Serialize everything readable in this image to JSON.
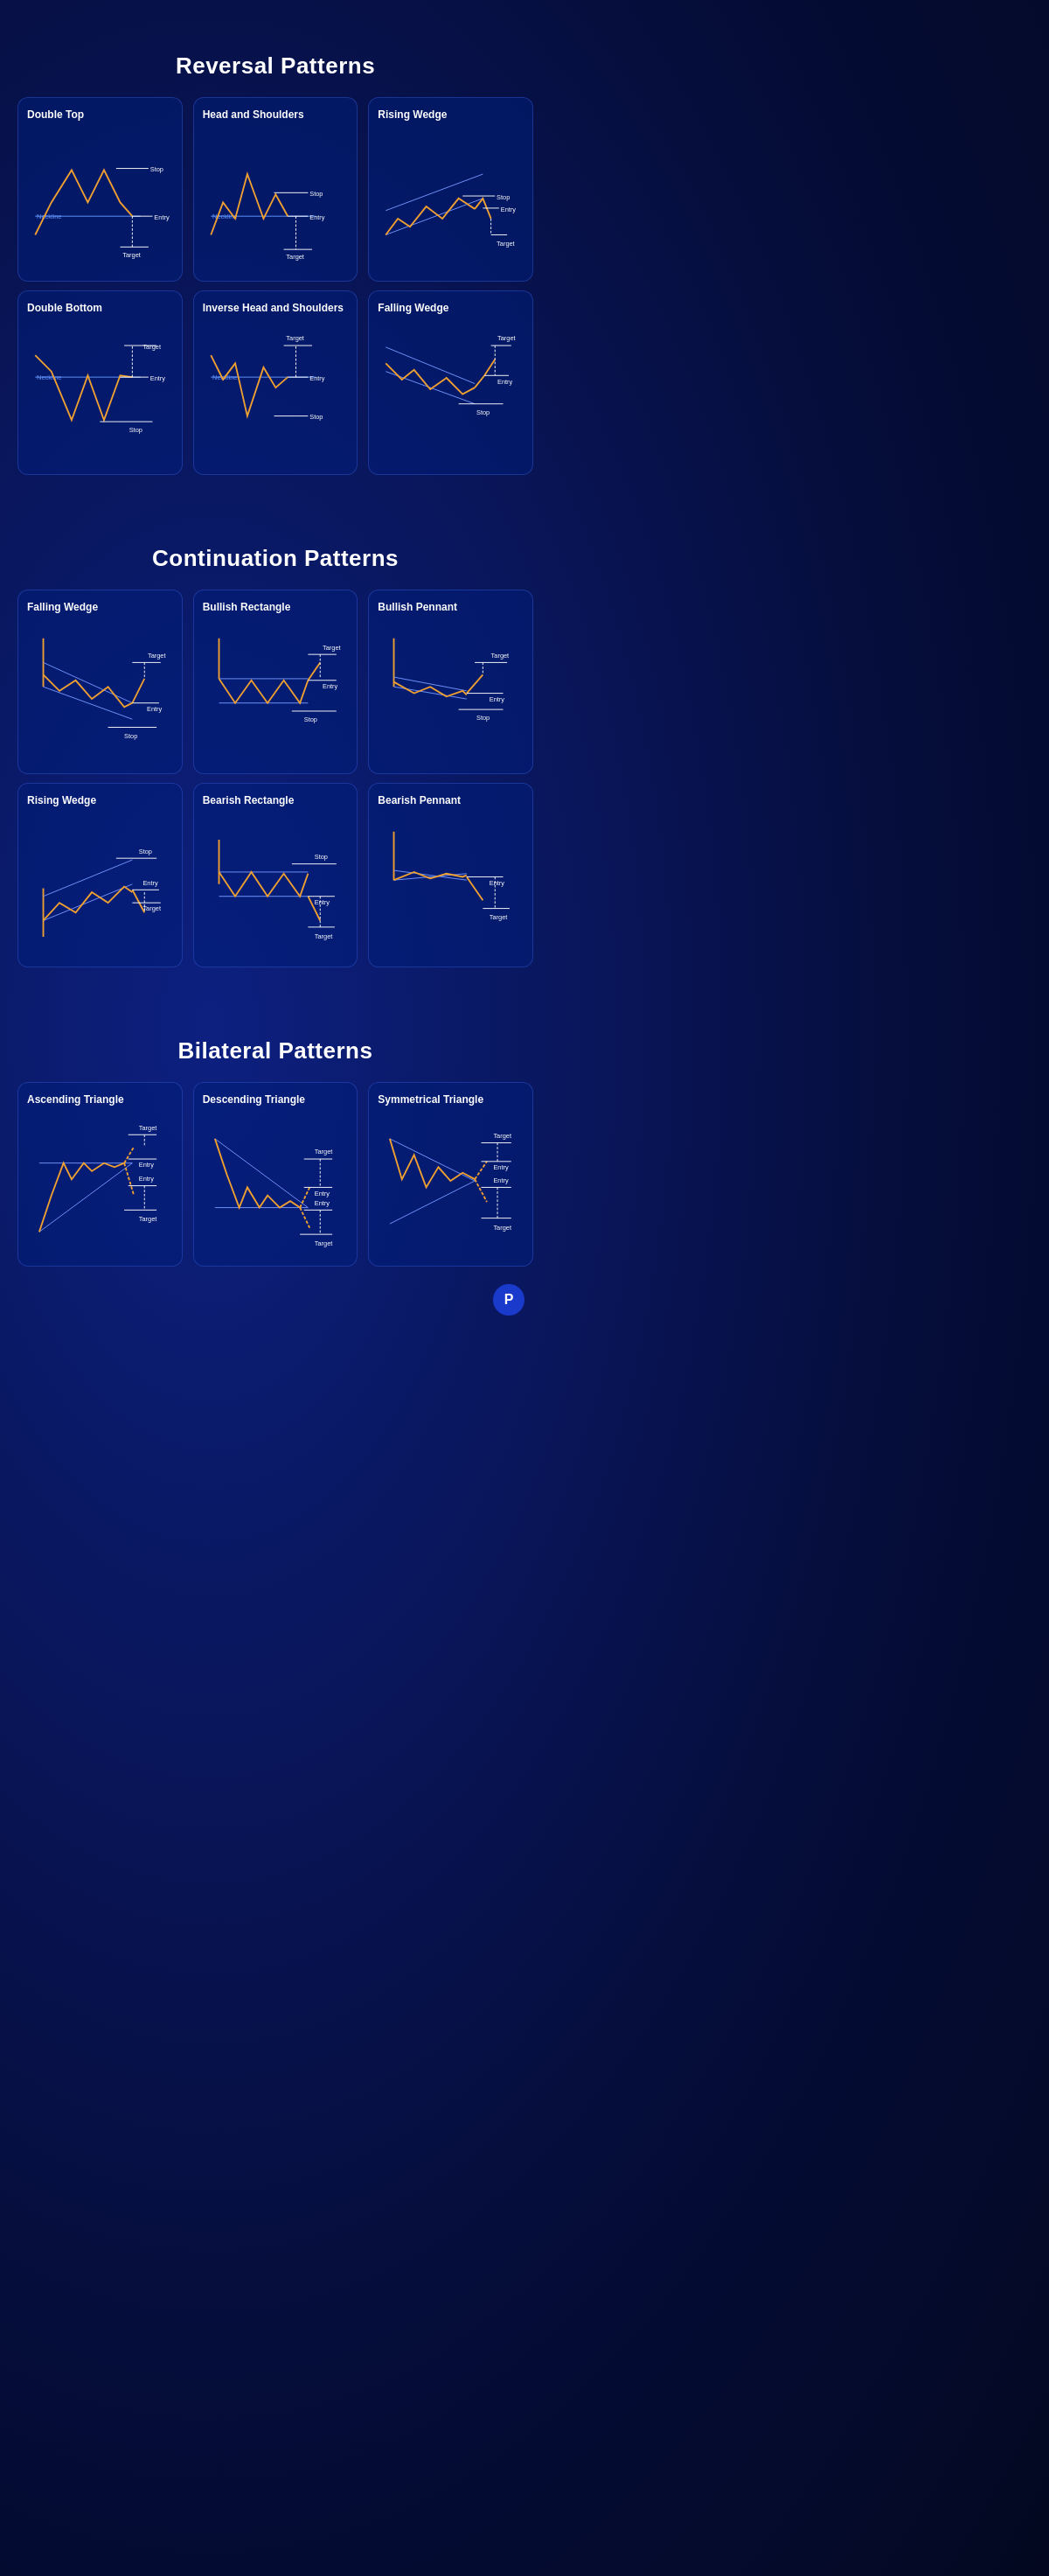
{
  "sections": [
    {
      "title": "Reversal Patterns",
      "rows": [
        [
          {
            "name": "Double Top",
            "type": "double_top"
          },
          {
            "name": "Head and Shoulders",
            "type": "head_shoulders"
          },
          {
            "name": "Rising Wedge",
            "type": "rising_wedge_rev"
          }
        ],
        [
          {
            "name": "Double Bottom",
            "type": "double_bottom"
          },
          {
            "name": "Inverse Head and Shoulders",
            "type": "inv_head_shoulders"
          },
          {
            "name": "Falling Wedge",
            "type": "falling_wedge_rev"
          }
        ]
      ]
    },
    {
      "title": "Continuation Patterns",
      "rows": [
        [
          {
            "name": "Falling Wedge",
            "type": "falling_wedge_cont"
          },
          {
            "name": "Bullish Rectangle",
            "type": "bullish_rectangle"
          },
          {
            "name": "Bullish Pennant",
            "type": "bullish_pennant"
          }
        ],
        [
          {
            "name": "Rising Wedge",
            "type": "rising_wedge_cont"
          },
          {
            "name": "Bearish Rectangle",
            "type": "bearish_rectangle"
          },
          {
            "name": "Bearish Pennant",
            "type": "bearish_pennant"
          }
        ]
      ]
    },
    {
      "title": "Bilateral Patterns",
      "rows": [
        [
          {
            "name": "Ascending Triangle",
            "type": "ascending_triangle"
          },
          {
            "name": "Descending Triangle",
            "type": "descending_triangle"
          },
          {
            "name": "Symmetrical Triangle",
            "type": "symmetrical_triangle"
          }
        ]
      ]
    }
  ]
}
